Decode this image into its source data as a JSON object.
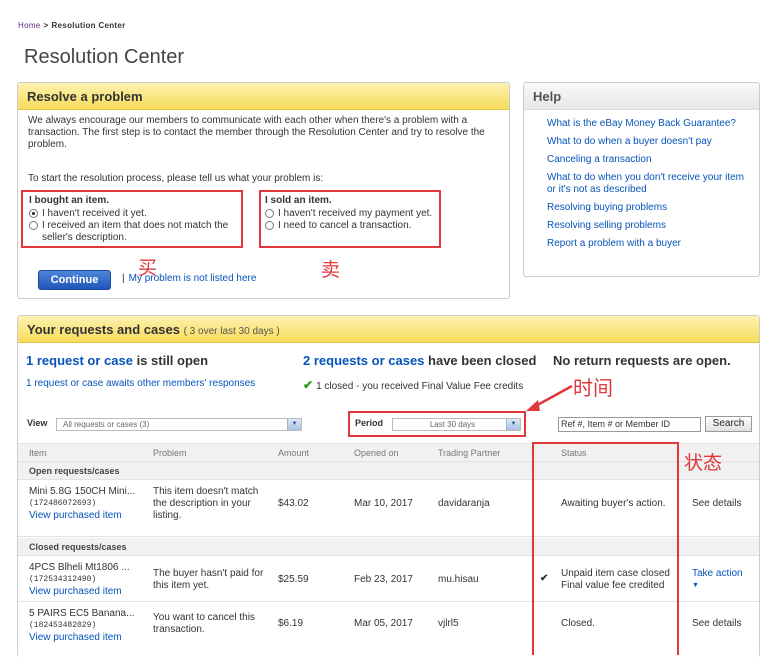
{
  "breadcrumb": {
    "home": "Home",
    "separator": ">",
    "current": "Resolution Center"
  },
  "page_title": "Resolution Center",
  "resolve_panel": {
    "title": "Resolve a problem",
    "intro": "We always encourage our members to communicate with each other when there's a problem with a transaction. The first step is to contact the member through the Resolution Center and try to resolve the problem.",
    "start_text": "To start the resolution process, please tell us what your problem is:",
    "bought": {
      "title": "I bought an item.",
      "opt1": "I haven't received it yet.",
      "opt2": "I received an item that does not match the seller's description.",
      "selected": "opt1"
    },
    "sold": {
      "title": "I sold an item.",
      "opt1": "I haven't received my payment yet.",
      "opt2": "I need to cancel a transaction."
    },
    "continue_label": "Continue",
    "not_listed_bar": "|",
    "not_listed_label": "My problem is not listed here"
  },
  "annotations": {
    "buy": "买",
    "sell": "卖",
    "time": "时间",
    "status": "状态",
    "color": "#e0373b"
  },
  "help": {
    "title": "Help",
    "links": [
      "What is the eBay Money Back Guarantee?",
      "What to do when a buyer doesn't pay",
      "Canceling a transaction",
      "What to do when you don't receive your item or it's not as described",
      "Resolving buying problems",
      "Resolving selling problems",
      "Report a problem with a buyer"
    ]
  },
  "requests": {
    "title": "Your requests and cases",
    "subtitle": "( 3 over last 30 days )",
    "open_summary": {
      "count_link": "1 request or case",
      "rest": " is still open",
      "detail": "1 request or case awaits other members' responses"
    },
    "closed_summary": {
      "count_link": "2 requests or cases",
      "rest": " have been closed",
      "detail": "1 closed - you received Final Value Fee credits"
    },
    "return_summary": "No return requests are open.",
    "filters": {
      "view_label": "View",
      "view_value": "All requests or cases (3)",
      "period_label": "Period",
      "period_value": "Last 30 days",
      "search_value": "Ref #, Item # or Member ID",
      "search_button": "Search"
    },
    "columns": [
      "Item",
      "Problem",
      "Amount",
      "Opened on",
      "Trading Partner",
      "Status"
    ],
    "open_group": "Open requests/cases",
    "closed_group": "Closed requests/cases",
    "rows": [
      {
        "item": "Mini 5.8G 150CH Mini...",
        "ref": "(172486072693)",
        "view": "View purchased item",
        "problem": "This item doesn't match the description in your listing.",
        "amount": "$43.02",
        "opened": "Mar 10, 2017",
        "partner": "davidaranja",
        "status": "Awaiting buyer's action.",
        "action": "See details"
      },
      {
        "item": "4PCS Blheli Mt1806 ...",
        "ref": "(172534312490)",
        "view": "View purchased item",
        "problem": "The buyer hasn't paid for this item yet.",
        "amount": "$25.59",
        "opened": "Feb 23, 2017",
        "partner": "mu.hisau",
        "status": "Unpaid item case closed Final value fee credited",
        "action": "Take action"
      },
      {
        "item": "5 PAIRS EC5 Banana...",
        "ref": "(182453482029)",
        "view": "View purchased item",
        "problem": "You want to cancel this transaction.",
        "amount": "$6.19",
        "opened": "Mar 05, 2017",
        "partner": "vjlrl5",
        "status": "Closed.",
        "action": "See details"
      }
    ]
  }
}
